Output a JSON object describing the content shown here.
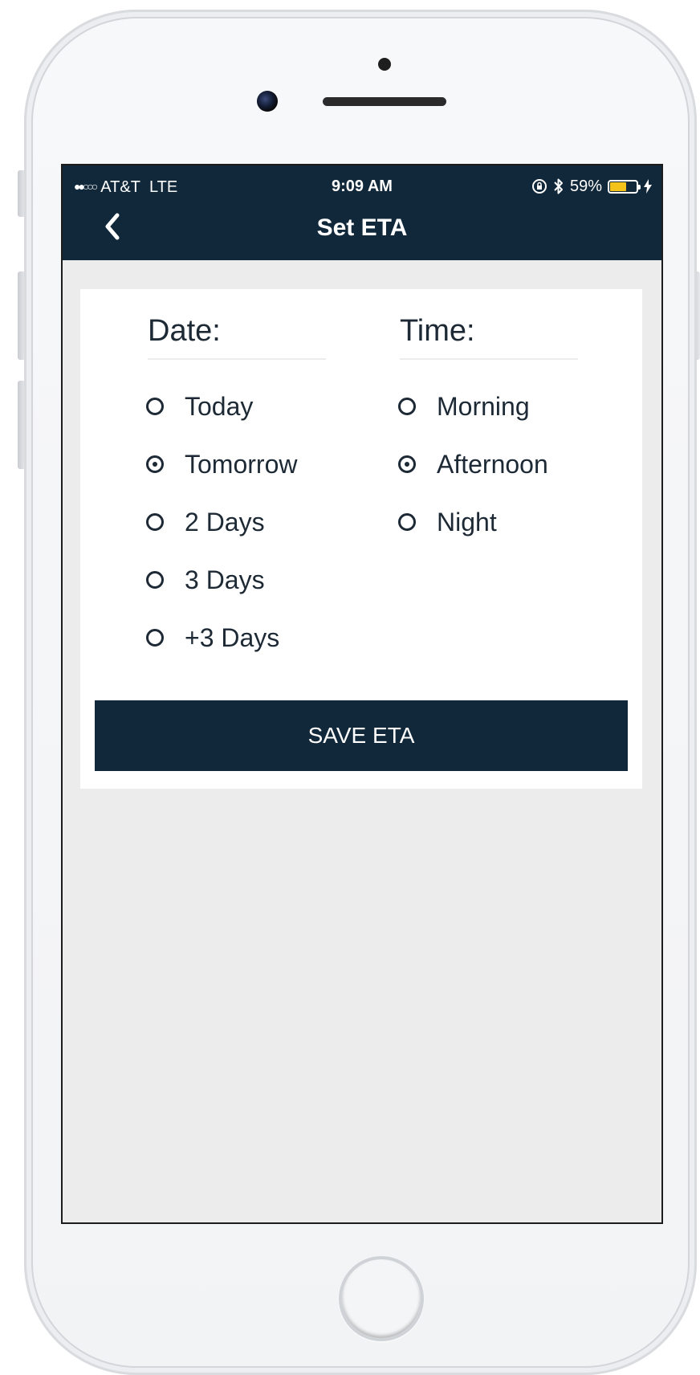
{
  "status_bar": {
    "carrier": "AT&T",
    "network": "LTE",
    "signal_dots": "●●○○○",
    "time": "9:09 AM",
    "battery_percent": "59%",
    "battery_level": 0.59,
    "battery_color": "#f3c31b",
    "icons": [
      "orientation-lock-icon",
      "bluetooth-icon",
      "battery-icon",
      "charging-bolt-icon"
    ]
  },
  "nav": {
    "title": "Set ETA",
    "back_icon": "chevron-left-icon"
  },
  "date": {
    "heading": "Date:",
    "options": [
      {
        "label": "Today",
        "selected": false
      },
      {
        "label": "Tomorrow",
        "selected": true
      },
      {
        "label": "2 Days",
        "selected": false
      },
      {
        "label": "3 Days",
        "selected": false
      },
      {
        "label": "+3 Days",
        "selected": false
      }
    ]
  },
  "time": {
    "heading": "Time:",
    "options": [
      {
        "label": "Morning",
        "selected": false
      },
      {
        "label": "Afternoon",
        "selected": true
      },
      {
        "label": "Night",
        "selected": false
      }
    ]
  },
  "save_button": {
    "label": "SAVE ETA"
  },
  "colors": {
    "primary": "#11283a",
    "background": "#ececec",
    "card": "#ffffff",
    "text": "#1d2a35"
  }
}
